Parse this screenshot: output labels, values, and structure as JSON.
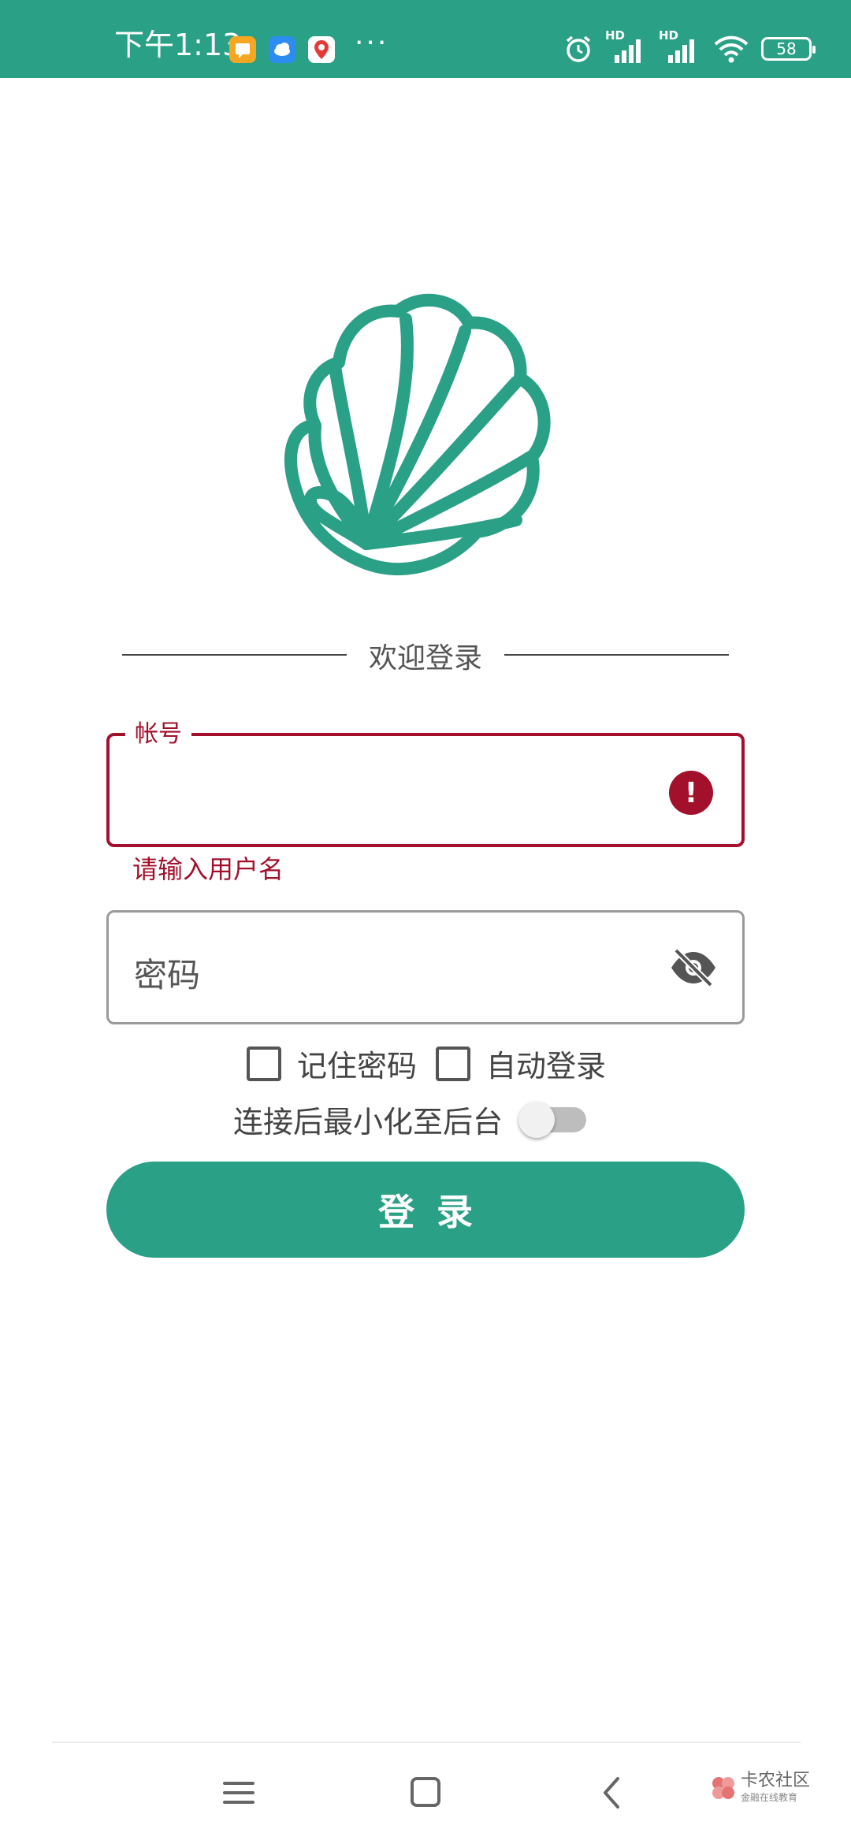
{
  "status_bar": {
    "time": "下午1:13",
    "battery": "58",
    "network_1": "HD",
    "network_2": "HD",
    "colors": {
      "bg": "#2aa086"
    },
    "icons": [
      "notification-app-icon",
      "cloud-app-icon",
      "map-app-icon",
      "more-dots-icon",
      "alarm-icon",
      "signal-icon",
      "signal-icon",
      "wifi-icon",
      "battery-icon"
    ]
  },
  "logo": {
    "icon": "shell-logo-icon",
    "color": "#2aa086"
  },
  "welcome": "欢迎登录",
  "account": {
    "label": "帐号",
    "value": "",
    "error": "请输入用户名",
    "error_color": "#a3102c"
  },
  "password": {
    "placeholder": "密码",
    "value": ""
  },
  "options": {
    "remember_password": "记住密码",
    "auto_login": "自动登录",
    "minimize_label": "连接后最小化至后台",
    "remember_checked": false,
    "auto_checked": false,
    "minimize_on": false
  },
  "login_button": "登录",
  "nav": {
    "icons": [
      "menu-icon",
      "home-icon",
      "back-icon"
    ]
  },
  "watermark": {
    "title": "卡农社区",
    "subtitle": "金融在线教育"
  }
}
